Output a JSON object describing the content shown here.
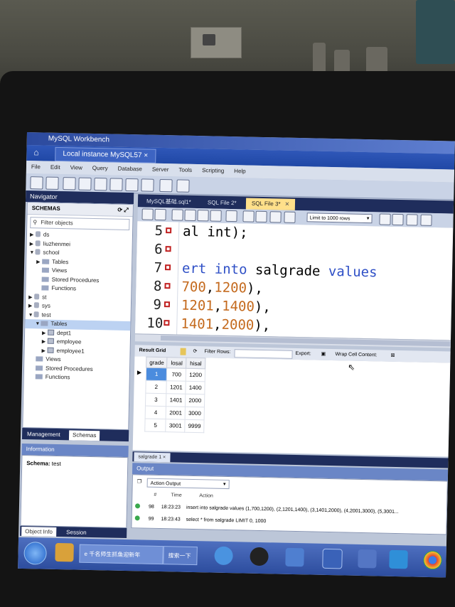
{
  "window": {
    "title": "MySQL Workbench",
    "connection_tab": "Local instance MySQL57 ×"
  },
  "menu": [
    "File",
    "Edit",
    "View",
    "Query",
    "Database",
    "Server",
    "Tools",
    "Scripting",
    "Help"
  ],
  "navigator": {
    "header": "Navigator",
    "schemas_title": "SCHEMAS",
    "filter_placeholder": "Filter objects",
    "tree": [
      "ds",
      "liuzhenmei",
      "school",
      "Tables",
      "Views",
      "Stored Procedures",
      "Functions",
      "st",
      "sys",
      "test",
      "Tables",
      "dept1",
      "employee",
      "employee1",
      "Views",
      "Stored Procedures",
      "Functions"
    ],
    "tabs": {
      "management": "Management",
      "schemas": "Schemas"
    }
  },
  "information": {
    "header": "Information",
    "label": "Schema:",
    "value": "test",
    "tabs": {
      "object_info": "Object Info",
      "session": "Session"
    }
  },
  "doc_tabs": [
    "MySQL基础.sql1*",
    "SQL File 2*",
    "SQL File 3*"
  ],
  "limit_select": "Limit to 1000 rows",
  "editor": {
    "lines": [
      {
        "num": "5",
        "parts": [
          {
            "t": "al int);",
            "c": ""
          }
        ]
      },
      {
        "num": "6",
        "parts": []
      },
      {
        "num": "7",
        "parts": [
          {
            "t": "ert ",
            "c": "kw"
          },
          {
            "t": "into ",
            "c": "kw"
          },
          {
            "t": "salgrade ",
            "c": ""
          },
          {
            "t": "values",
            "c": "kw"
          }
        ]
      },
      {
        "num": "8",
        "parts": [
          {
            "t": "700",
            "c": "num"
          },
          {
            "t": ",",
            "c": ""
          },
          {
            "t": "1200",
            "c": "num"
          },
          {
            "t": "),",
            "c": ""
          }
        ]
      },
      {
        "num": "9",
        "parts": [
          {
            "t": "1201",
            "c": "num"
          },
          {
            "t": ",",
            "c": ""
          },
          {
            "t": "1400",
            "c": "num"
          },
          {
            "t": "),",
            "c": ""
          }
        ]
      },
      {
        "num": "10",
        "parts": [
          {
            "t": "1401",
            "c": "num"
          },
          {
            "t": ",",
            "c": ""
          },
          {
            "t": "2000",
            "c": "num"
          },
          {
            "t": "),",
            "c": ""
          }
        ]
      }
    ]
  },
  "result_bar": {
    "result_grid": "Result Grid",
    "filter_rows": "Filter Rows:",
    "export": "Export:",
    "wrap": "Wrap Cell Content:"
  },
  "result_grid": {
    "columns": [
      "grade",
      "losal",
      "hisal"
    ],
    "rows": [
      [
        "1",
        "700",
        "1200"
      ],
      [
        "2",
        "1201",
        "1400"
      ],
      [
        "3",
        "1401",
        "2000"
      ],
      [
        "4",
        "2001",
        "3000"
      ],
      [
        "5",
        "3001",
        "9999"
      ]
    ]
  },
  "result_tab": "salgrade 1 ×",
  "output": {
    "header": "Output",
    "selector": "Action Output",
    "columns": [
      "#",
      "Time",
      "Action"
    ],
    "rows": [
      {
        "n": "98",
        "time": "18:23:23",
        "action": "insert into salgrade values (1,700,1200), (2,1201,1400), (3,1401,2000), (4,2001,3000), (5,3001..."
      },
      {
        "n": "99",
        "time": "18:23:43",
        "action": "select * from salgrade LIMIT 0, 1000"
      }
    ]
  },
  "taskbar": {
    "browser_task": "千名师生抓鱼迎新年",
    "search": "搜索一下"
  },
  "colors": {
    "accent": "#1f2d5c",
    "selected_cell": "#4b8cde",
    "keyword": "#2e4fc6",
    "number": "#c46a1e"
  }
}
